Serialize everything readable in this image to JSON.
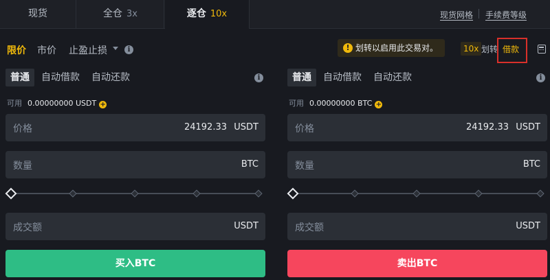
{
  "tabs": {
    "spot": "现货",
    "cross": "全仓",
    "cross_leverage": "3x",
    "isolated": "逐仓",
    "isolated_leverage": "10x"
  },
  "links": {
    "spot_grid": "现货网格",
    "fee_tier": "手续费等级"
  },
  "order_types": {
    "limit": "限价",
    "market": "市价",
    "stop_limit": "止盈止损",
    "active": "limit"
  },
  "notice": {
    "text": "划转以启用此交易对。"
  },
  "margin_actions": {
    "leverage": "10x",
    "transfer": "划转",
    "borrow": "借款"
  },
  "buy_panel": {
    "modes": [
      "普通",
      "自动借款",
      "自动还款"
    ],
    "available_label": "可用",
    "available_value": "0.00000000 USDT",
    "price_label": "价格",
    "price_value": "24192.33",
    "price_unit": "USDT",
    "qty_label": "数量",
    "qty_unit": "BTC",
    "total_label": "成交额",
    "total_unit": "USDT",
    "slider_level": 0,
    "button": "买入BTC"
  },
  "sell_panel": {
    "modes": [
      "普通",
      "自动借款",
      "自动还款"
    ],
    "available_label": "可用",
    "available_value": "0.00000000 BTC",
    "price_label": "价格",
    "price_value": "24192.33",
    "price_unit": "USDT",
    "qty_label": "数量",
    "qty_unit": "BTC",
    "total_label": "成交额",
    "total_unit": "USDT",
    "slider_level": 0,
    "button": "卖出BTC"
  },
  "colors": {
    "accent": "#f0b90b",
    "buy": "#2ebd85",
    "sell": "#f6465d",
    "background": "#181a20",
    "highlight_box": "#d9302a"
  }
}
